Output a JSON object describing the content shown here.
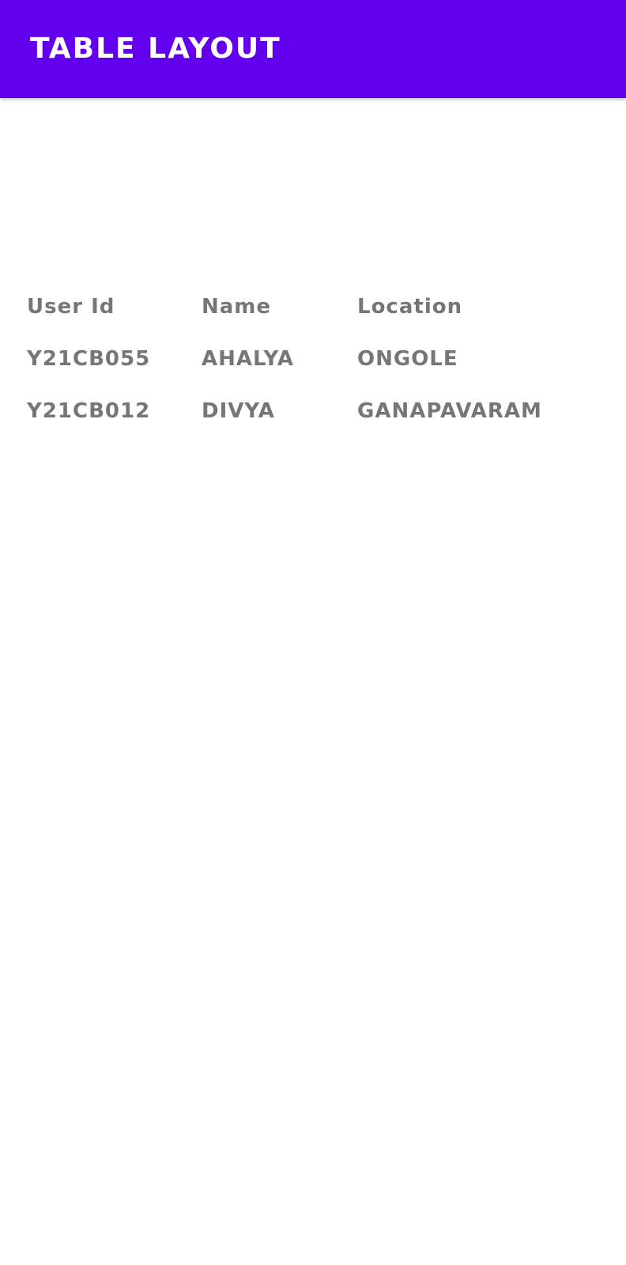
{
  "app_bar": {
    "title": "TABLE LAYOUT",
    "background_color": "#6200EE",
    "title_color": "#FFFFFF"
  },
  "table": {
    "text_color": "#767676",
    "headers": [
      "User Id",
      "Name",
      "Location"
    ],
    "rows": [
      [
        "Y21CB055",
        "AHALYA",
        "ONGOLE"
      ],
      [
        "Y21CB012",
        "DIVYA",
        "GANAPAVARAM"
      ]
    ]
  }
}
